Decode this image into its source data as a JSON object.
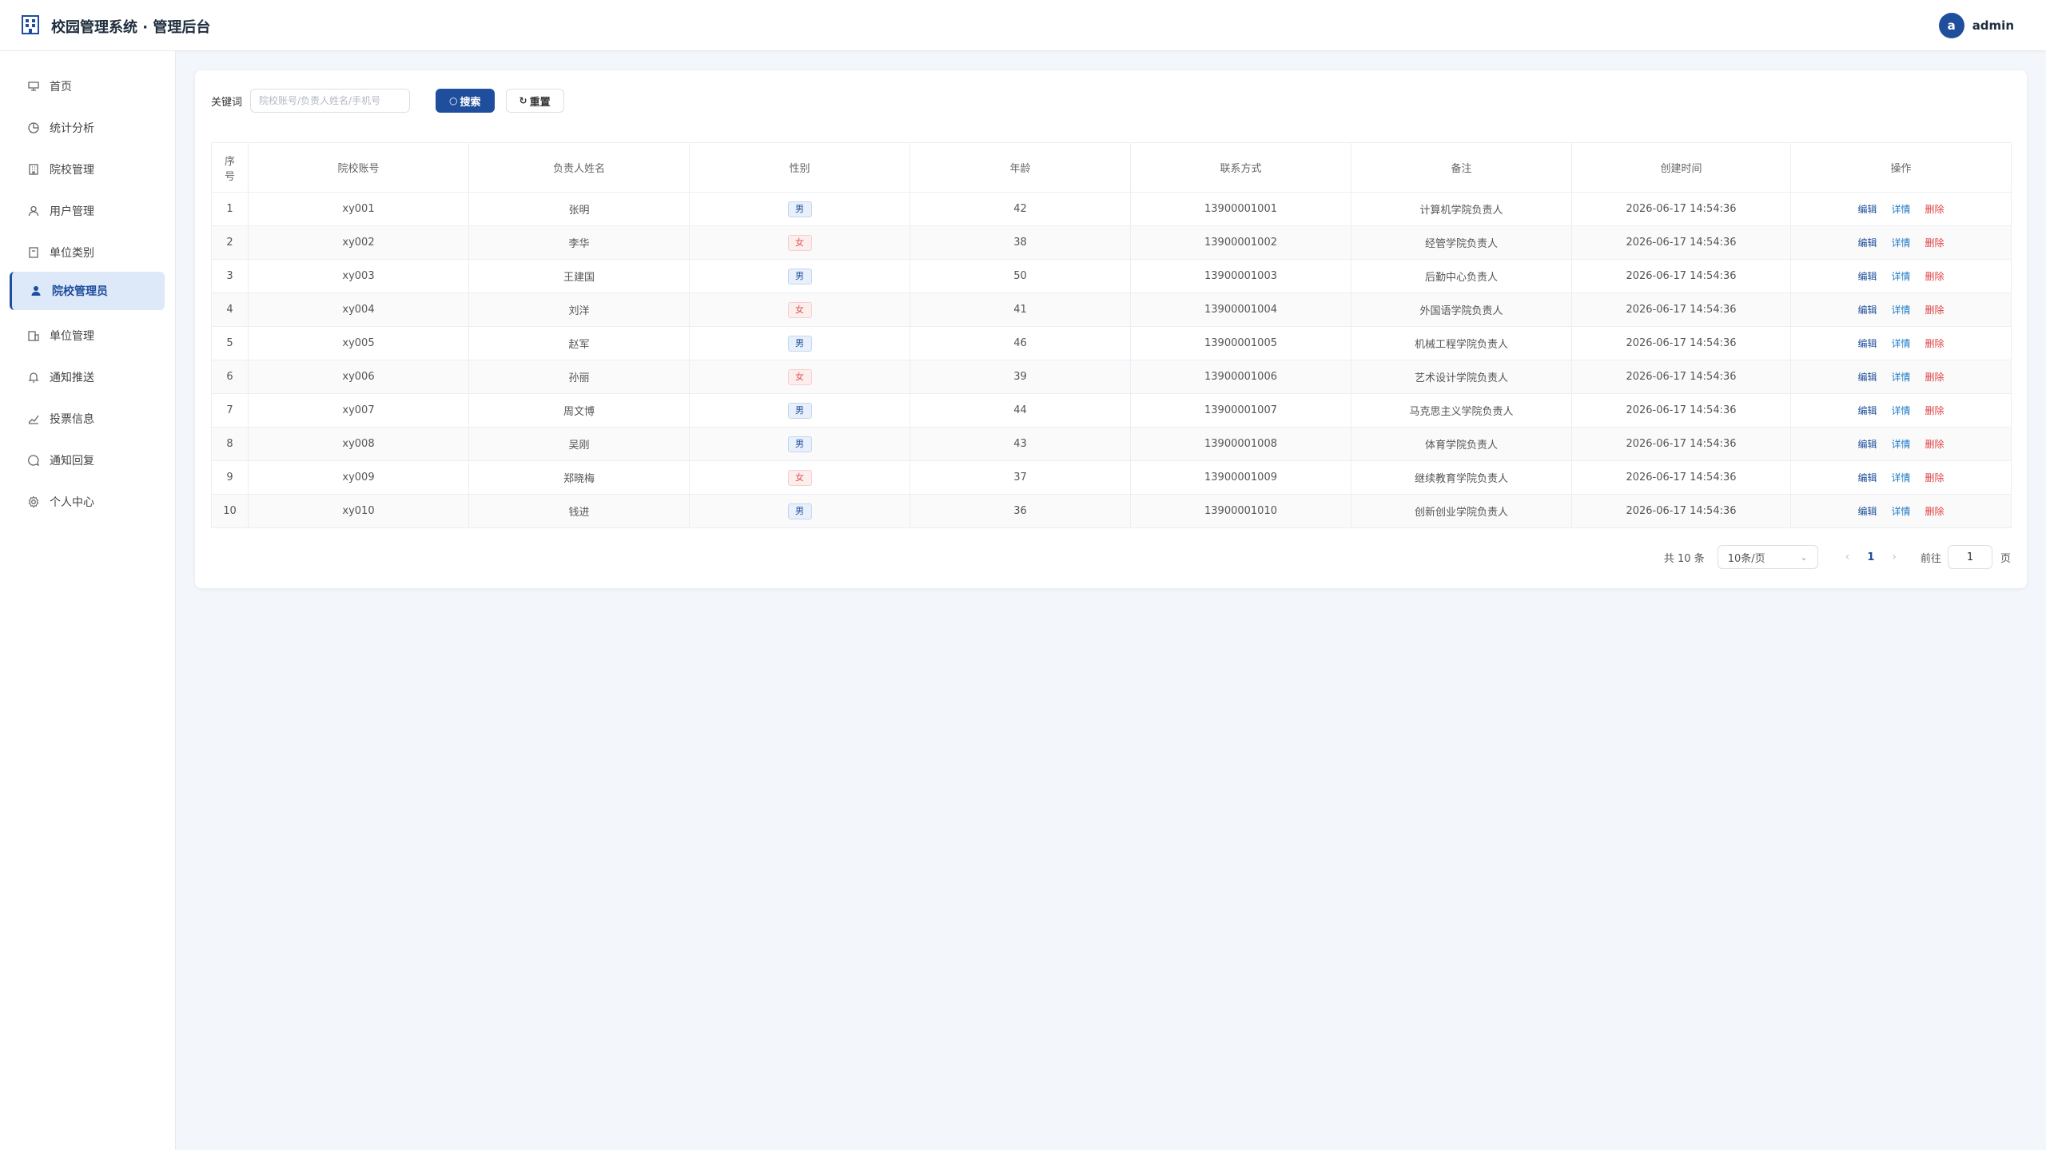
{
  "header": {
    "title": "校园管理系统 · 管理后台",
    "avatar_letter": "a",
    "username": "admin"
  },
  "sidebar": {
    "items": [
      {
        "label": "首页",
        "icon": "home-icon"
      },
      {
        "label": "统计分析",
        "icon": "pie-chart-icon"
      },
      {
        "label": "院校管理",
        "icon": "building-icon"
      },
      {
        "label": "用户管理",
        "icon": "user-icon"
      },
      {
        "label": "单位类别",
        "icon": "category-icon"
      },
      {
        "label": "院校管理员",
        "icon": "user-filled-icon",
        "active": true
      },
      {
        "label": "单位管理",
        "icon": "office-icon"
      },
      {
        "label": "通知推送",
        "icon": "bell-icon"
      },
      {
        "label": "投票信息",
        "icon": "vote-icon"
      },
      {
        "label": "通知回复",
        "icon": "chat-icon"
      },
      {
        "label": "个人中心",
        "icon": "gear-icon"
      }
    ]
  },
  "search": {
    "label": "关键词",
    "placeholder": "院校账号/负责人姓名/手机号",
    "search_button": "搜索",
    "reset_button": "重置"
  },
  "table": {
    "headers": [
      "序号",
      "院校账号",
      "负责人姓名",
      "性别",
      "年龄",
      "联系方式",
      "备注",
      "创建时间",
      "操作"
    ],
    "rows": [
      {
        "no": "1",
        "account": "xy001",
        "name": "张明",
        "gender": "男",
        "age": "42",
        "phone": "13900001001",
        "remark": "计算机学院负责人",
        "created": "2026-06-17 14:54:36"
      },
      {
        "no": "2",
        "account": "xy002",
        "name": "李华",
        "gender": "女",
        "age": "38",
        "phone": "13900001002",
        "remark": "经管学院负责人",
        "created": "2026-06-17 14:54:36"
      },
      {
        "no": "3",
        "account": "xy003",
        "name": "王建国",
        "gender": "男",
        "age": "50",
        "phone": "13900001003",
        "remark": "后勤中心负责人",
        "created": "2026-06-17 14:54:36"
      },
      {
        "no": "4",
        "account": "xy004",
        "name": "刘洋",
        "gender": "女",
        "age": "41",
        "phone": "13900001004",
        "remark": "外国语学院负责人",
        "created": "2026-06-17 14:54:36"
      },
      {
        "no": "5",
        "account": "xy005",
        "name": "赵军",
        "gender": "男",
        "age": "46",
        "phone": "13900001005",
        "remark": "机械工程学院负责人",
        "created": "2026-06-17 14:54:36"
      },
      {
        "no": "6",
        "account": "xy006",
        "name": "孙丽",
        "gender": "女",
        "age": "39",
        "phone": "13900001006",
        "remark": "艺术设计学院负责人",
        "created": "2026-06-17 14:54:36"
      },
      {
        "no": "7",
        "account": "xy007",
        "name": "周文博",
        "gender": "男",
        "age": "44",
        "phone": "13900001007",
        "remark": "马克思主义学院负责人",
        "created": "2026-06-17 14:54:36"
      },
      {
        "no": "8",
        "account": "xy008",
        "name": "吴刚",
        "gender": "男",
        "age": "43",
        "phone": "13900001008",
        "remark": "体育学院负责人",
        "created": "2026-06-17 14:54:36"
      },
      {
        "no": "9",
        "account": "xy009",
        "name": "郑晓梅",
        "gender": "女",
        "age": "37",
        "phone": "13900001009",
        "remark": "继续教育学院负责人",
        "created": "2026-06-17 14:54:36"
      },
      {
        "no": "10",
        "account": "xy010",
        "name": "钱进",
        "gender": "男",
        "age": "36",
        "phone": "13900001010",
        "remark": "创新创业学院负责人",
        "created": "2026-06-17 14:54:36"
      }
    ],
    "actions": {
      "edit": "编辑",
      "detail": "详情",
      "delete": "删除"
    }
  },
  "pagination": {
    "total_text": "共 10 条",
    "page_size": "10条/页",
    "current_page": "1",
    "goto_label": "前往",
    "goto_value": "1",
    "page_unit": "页"
  },
  "colors": {
    "primary": "#1e4e9c",
    "male_tag": "#1e4e9c",
    "female_tag": "#e05252",
    "delete": "#e04343"
  }
}
